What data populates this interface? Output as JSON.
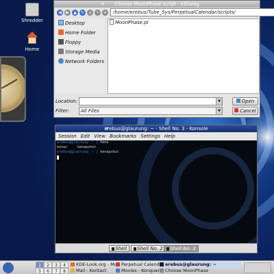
{
  "desktop": {
    "icons": [
      {
        "label": "Shredder"
      },
      {
        "label": "Home"
      }
    ]
  },
  "kdialog": {
    "title": "Choose MoonPhase script - KDialog",
    "path": "/home/erebus/Tube_Sys/PerpetualCalendar/scripts/",
    "places": [
      "Desktop",
      "Home Folder",
      "Floppy",
      "Storage Media",
      "Network Folders"
    ],
    "files": [
      "MoonPhase.pl"
    ],
    "location_label": "Location:",
    "location_value": "",
    "filter_label": "Filter:",
    "filter_value": "All Files",
    "open_label": "Open",
    "cancel_label": "Cancel"
  },
  "konsole": {
    "title": "erebus@glaurung: ~ - Shell No. 3 - Konsole",
    "menu": [
      "Session",
      "Edit",
      "View",
      "Bookmarks",
      "Settings",
      "Help"
    ],
    "lines": [
      {
        "prompt": "erebus@glaurung: ~ ] ",
        "text": "kena"
      },
      {
        "prompt": "",
        "text": "kenaz     kenapshut"
      },
      {
        "prompt": "erebus@glaurung: ~ ] ",
        "text": "kenapshut"
      }
    ],
    "tabs": [
      "Shell",
      "Shell No. 2",
      "Shell No. 3"
    ]
  },
  "taskbar": {
    "pager": [
      "1",
      "2",
      "3",
      "4",
      "5",
      "6",
      "7",
      "8"
    ],
    "active_desktop": "1",
    "tasks": [
      "KDE-Look.org - Moz",
      "Mail - Kontact",
      "Perpetual Calendar",
      "Movies - Konqueror",
      "erebus@glaurung: ~",
      "Choose MoonPhase"
    ]
  },
  "colors": {
    "desktop_blue": "#0d2a6e",
    "konsole_title": "#15306e",
    "prompt_blue": "#4f7ac8"
  }
}
